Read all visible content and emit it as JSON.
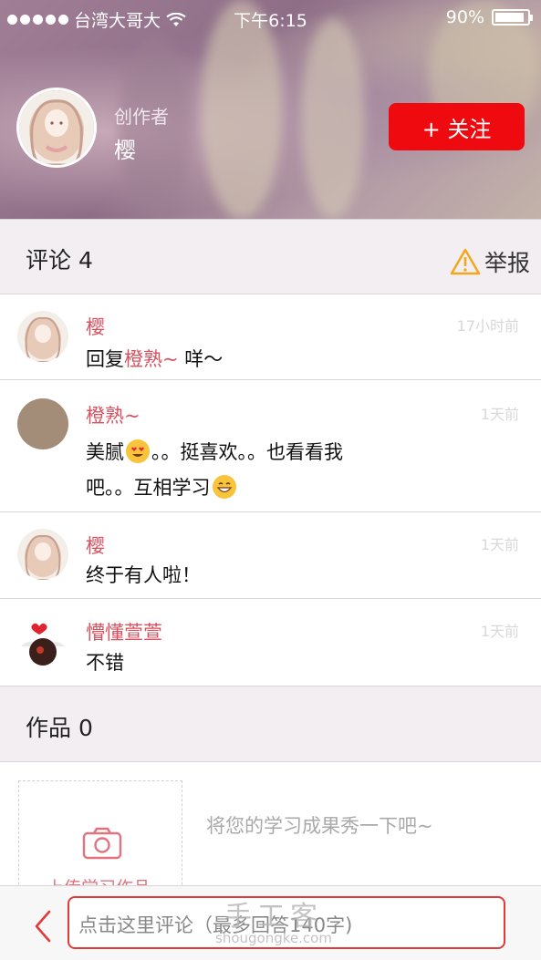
{
  "status_bar": {
    "carrier": "台湾大哥大",
    "time": "下午6:15",
    "battery": "90%",
    "battery_level": 0.9
  },
  "profile": {
    "role_label": "创作者",
    "name": "樱",
    "follow_label": "+ 关注",
    "accent_color": "#ee0a0f"
  },
  "comments_section": {
    "title": "评论 4",
    "report_label": "举报",
    "items": [
      {
        "name": "樱",
        "time": "17小时前",
        "text_prefix": "回复",
        "reply_to": "橙熟~",
        "text": " 咩～"
      },
      {
        "name": "橙熟~",
        "time": "1天前",
        "line1": "美腻",
        "line1b": "。。挺喜欢。。也看看我",
        "line2": "吧。。互相学习"
      },
      {
        "name": "樱",
        "time": "1天前",
        "text": "终于有人啦！"
      },
      {
        "name": "懵懂萱萱",
        "time": "1天前",
        "text": "不错"
      }
    ]
  },
  "works_section": {
    "title": "作品 0",
    "upload_label": "上传学习作品",
    "hint": "将您的学习成果秀一下吧~"
  },
  "bottom_bar": {
    "input_placeholder": "点击这里评论（最多回答140字)"
  },
  "watermark": {
    "line1": "手工客",
    "line2": "shougongke.com"
  }
}
